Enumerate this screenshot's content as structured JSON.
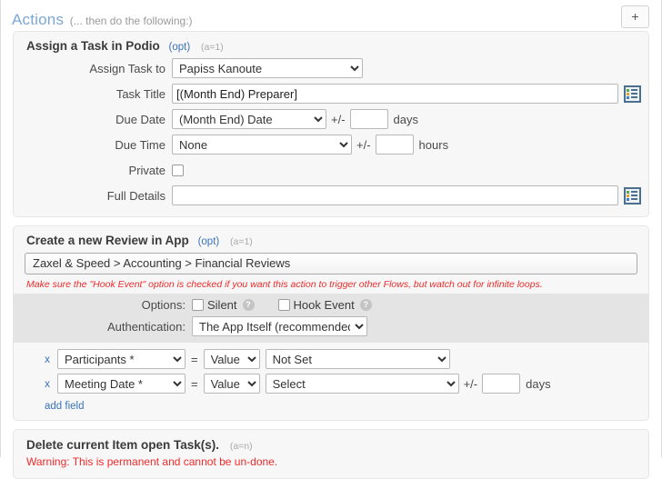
{
  "header": {
    "title": "Actions",
    "subtitle": "(... then do the following:)",
    "add_button_label": "+"
  },
  "panels": {
    "assign_task": {
      "title": "Assign a Task in Podio",
      "opt_tag": "(opt)",
      "count_tag": "(a=1)",
      "fields": {
        "assign_to_label": "Assign Task to",
        "assign_to_value": "Papiss Kanoute",
        "task_title_label": "Task Title",
        "task_title_value": "[(Month End) Preparer]",
        "due_date_label": "Due Date",
        "due_date_value": "(Month End) Date",
        "due_date_offset": "",
        "due_date_unit": "days",
        "due_time_label": "Due Time",
        "due_time_value": "None",
        "due_time_offset": "",
        "due_time_unit": "hours",
        "private_label": "Private",
        "full_details_label": "Full Details",
        "full_details_value": "",
        "plus_minus": "+/-"
      }
    },
    "create_review": {
      "title": "Create a new Review in App",
      "opt_tag": "(opt)",
      "count_tag": "(a=1)",
      "app_path": "Zaxel & Speed > Accounting > Financial Reviews",
      "warning": "Make sure the \"Hook Event\" option is checked if you want this action to trigger other Flows, but watch out for infinite loops.",
      "options_label": "Options:",
      "option_silent": "Silent",
      "option_hook_event": "Hook Event",
      "help_glyph": "?",
      "authentication_label": "Authentication:",
      "authentication_value": "The App Itself (recommended)",
      "remove_glyph": "x",
      "equals_glyph": "=",
      "plus_minus": "+/-",
      "add_field_label": "add field",
      "mappings": [
        {
          "field": "Participants *",
          "operator": "Value",
          "value": "Not Set",
          "offset": "",
          "unit": ""
        },
        {
          "field": "Meeting Date *",
          "operator": "Value",
          "value": "Select",
          "offset": "",
          "unit": "days"
        }
      ]
    },
    "delete_tasks": {
      "title": "Delete current Item open Task(s).",
      "count_tag": "(a=n)",
      "warning": "Warning: This is permanent and cannot be un-done."
    }
  },
  "colors": {
    "title_blue": "#7ba7d7",
    "link_blue": "#3b73b9",
    "warning_red": "#ef2b2b",
    "panel_bg": "#f7f7f7",
    "band_bg": "#e4e4e4"
  }
}
